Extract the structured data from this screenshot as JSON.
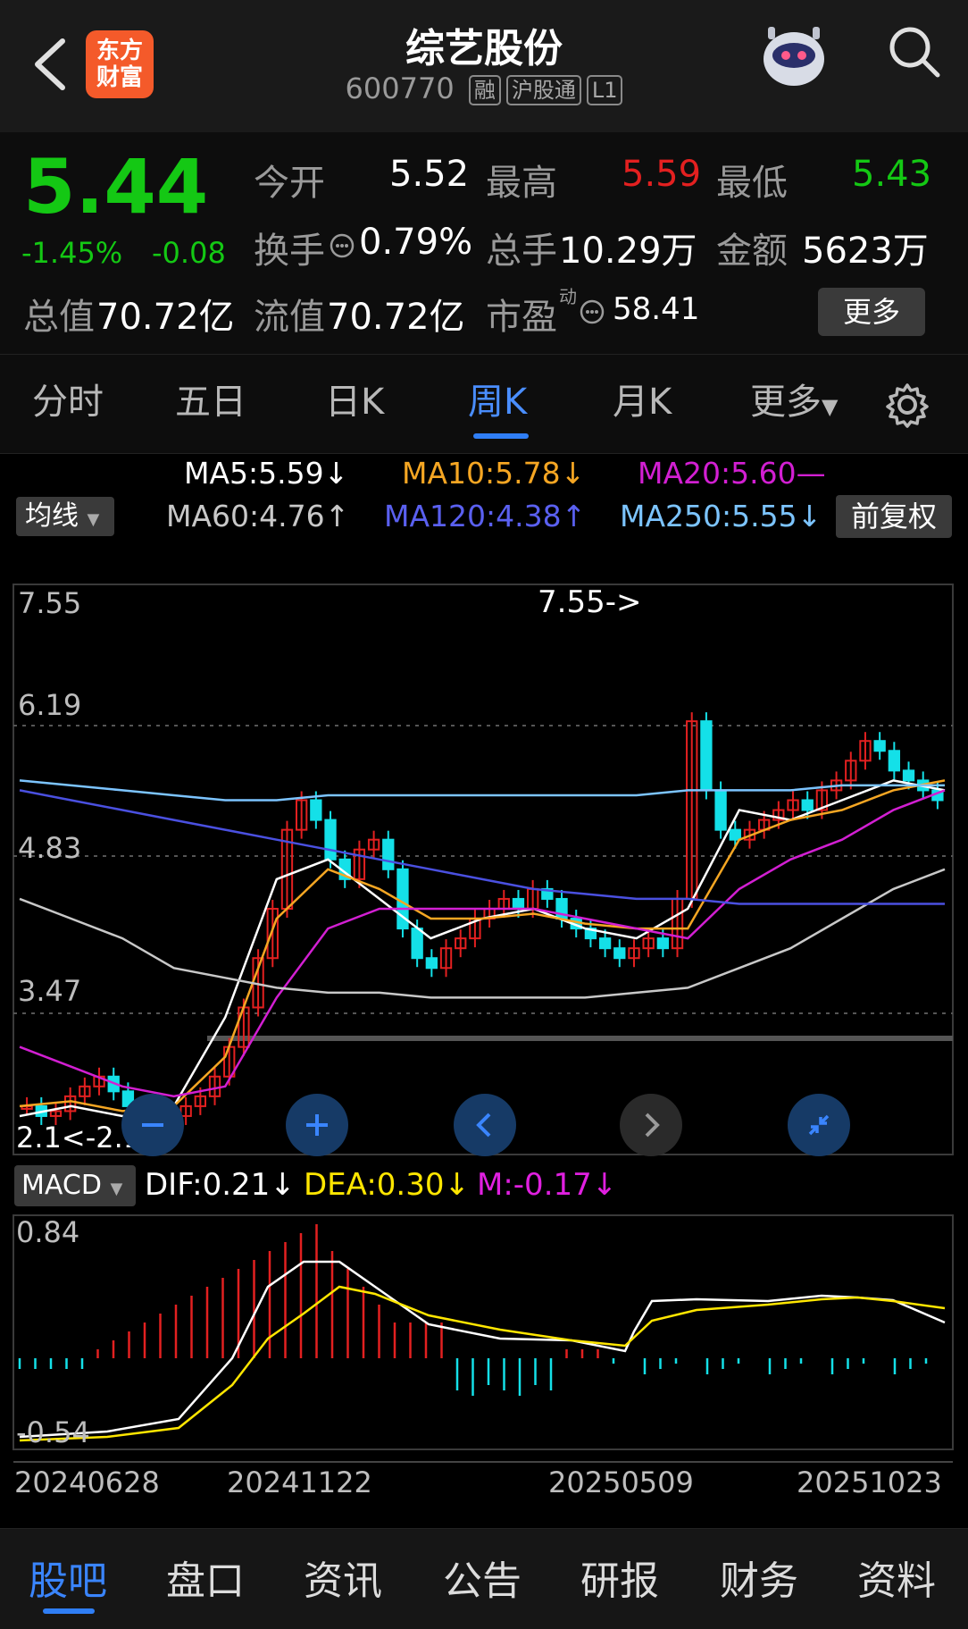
{
  "header": {
    "title": "综艺股份",
    "code": "600770",
    "tags": [
      "融",
      "沪股通",
      "L1"
    ],
    "logo_lines": [
      "东方",
      "财富"
    ]
  },
  "quote": {
    "price": "5.44",
    "change_pct": "-1.45%",
    "change": "-0.08",
    "open_label": "今开",
    "open": "5.52",
    "high_label": "最高",
    "high": "5.59",
    "low_label": "最低",
    "low": "5.43",
    "turnover_label": "换手",
    "turnover": "0.79%",
    "volume_label": "总手",
    "volume": "10.29万",
    "amount_label": "金额",
    "amount": "5623万",
    "mktcap_label": "总值",
    "mktcap": "70.72亿",
    "float_label": "流值",
    "float": "70.72亿",
    "pe_label": "市盈",
    "pe_sup": "动",
    "pe": "58.41",
    "more_label": "更多"
  },
  "tabs": [
    "分时",
    "五日",
    "日K",
    "周K",
    "月K",
    "更多"
  ],
  "active_tab": "周K",
  "ma_legend": {
    "ma5": "MA5:5.59↓",
    "ma10": "MA10:5.78↓",
    "ma20": "MA20:5.60—",
    "ma60": "MA60:4.76↑",
    "ma120": "MA120:4.38↑",
    "ma250": "MA250:5.55↓",
    "junxian": "均线",
    "fuquan": "前复权"
  },
  "colors": {
    "ma5": "#ffffff",
    "ma10": "#f5a623",
    "ma20": "#d21fd2",
    "ma60": "#c8c8c8",
    "ma120": "#4a50e0",
    "ma250": "#7cc4ff",
    "up": "#e32020",
    "down": "#14e0e8",
    "green": "#14c814",
    "blue": "#3a85ff"
  },
  "kline": {
    "y_ticks": [
      "7.55",
      "6.19",
      "4.83",
      "3.47"
    ],
    "max_marker": "7.55->",
    "min_marker": "2.1<-2.1",
    "ylim": [
      2.1,
      7.55
    ]
  },
  "macd": {
    "label": "MACD",
    "dif": "DIF:0.21↓",
    "dea": "DEA:0.30↓",
    "m": "M:-0.17↓",
    "y_ticks": [
      "0.84",
      "-0.54"
    ]
  },
  "x_ticks": [
    "20240628",
    "20241122",
    "20250509",
    "20251023"
  ],
  "bottom_nav": [
    "股吧",
    "盘口",
    "资讯",
    "公告",
    "研报",
    "财务",
    "资料"
  ],
  "active_bottom": "股吧"
}
